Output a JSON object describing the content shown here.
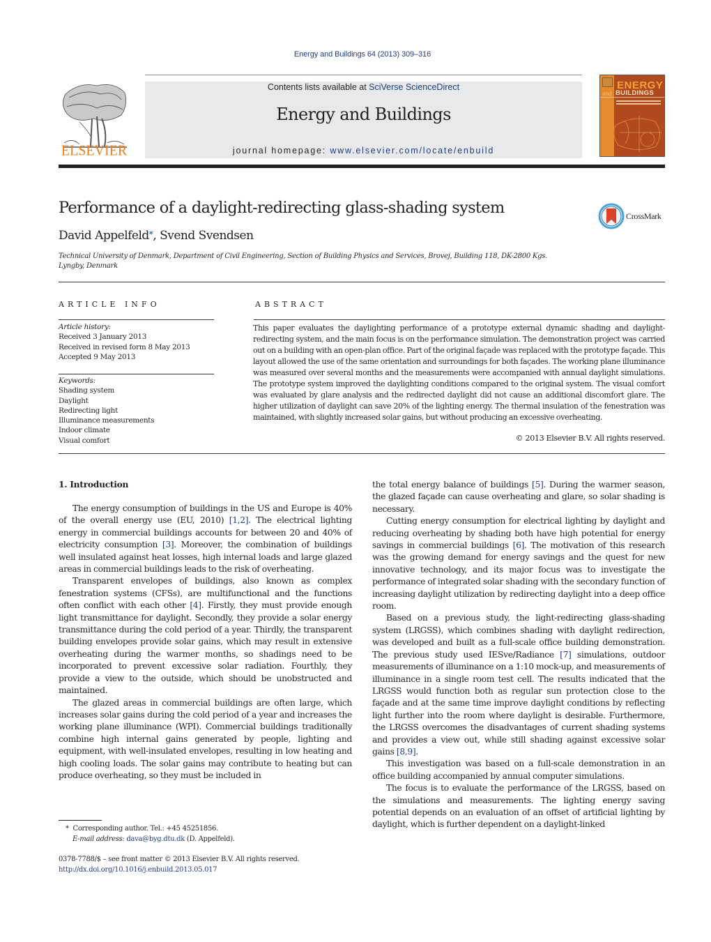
{
  "header": {
    "citation": "Energy and Buildings 64 (2013) 309–316",
    "contents_prefix": "Contents lists available at ",
    "contents_link": "SciVerse ScienceDirect",
    "journal_title": "Energy and Buildings",
    "homepage_prefix": "journal homepage: ",
    "homepage_link": "www.elsevier.com/locate/enbuild",
    "publisher_logo_text": "ELSEVIER",
    "cover": {
      "title_line1": "ENERGY",
      "title_and": "and",
      "title_line2": "BUILDINGS"
    },
    "colors": {
      "link": "#1f3c88",
      "elsevier_orange": "#f07f1a",
      "masthead_bg": "#e8e9ea"
    }
  },
  "article": {
    "title": "Performance of a daylight-redirecting glass-shading system",
    "crossmark_label": "CrossMark",
    "authors": {
      "author1": "David Appelfeld",
      "author1_mark": "*",
      "separator": ", ",
      "author2": "Svend Svendsen"
    },
    "affiliation": "Technical University of Denmark, Department of Civil Engineering, Section of Building Physics and Services, Brovej, Building 118, DK-2800 Kgs. Lyngby, Denmark"
  },
  "article_info": {
    "heading": "ARTICLE INFO",
    "history_label": "Article history:",
    "history": [
      "Received 3 January 2013",
      "Received in revised form 8 May 2013",
      "Accepted 9 May 2013"
    ],
    "keywords_label": "Keywords:",
    "keywords": [
      "Shading system",
      "Daylight",
      "Redirecting light",
      "Illuminance measurements",
      "Indoor climate",
      "Visual comfort"
    ]
  },
  "abstract": {
    "heading": "ABSTRACT",
    "text": "This paper evaluates the daylighting performance of a prototype external dynamic shading and daylight-redirecting system, and the main focus is on the performance simulation. The demonstration project was carried out on a building with an open-plan office. Part of the original façade was replaced with the prototype façade. This layout allowed the use of the same orientation and surroundings for both façades. The working plane illuminance was measured over several months and the measurements were accompanied with annual daylight simulations. The prototype system improved the daylighting conditions compared to the original system. The visual comfort was evaluated by glare analysis and the redirected daylight did not cause an additional discomfort glare. The higher utilization of daylight can save 20% of the lighting energy. The thermal insulation of the fenestration was maintained, with slightly increased solar gains, but without producing an excessive overheating.",
    "copyright": "© 2013 Elsevier B.V. All rights reserved."
  },
  "body": {
    "section_heading": "1.  Introduction",
    "left_column": [
      {
        "segments": [
          {
            "t": "The energy consumption of buildings in the US and Europe is 40% of the overall energy use (EU, 2010) "
          },
          {
            "t": "[1,2]",
            "ref": true
          },
          {
            "t": ". The electrical lighting energy in commercial buildings accounts for between 20 and 40% of electricity consumption "
          },
          {
            "t": "[3]",
            "ref": true
          },
          {
            "t": ". Moreover, the combination of buildings well insulated against heat losses, high internal loads and large glazed areas in commercial buildings leads to the risk of overheating."
          }
        ]
      },
      {
        "segments": [
          {
            "t": "Transparent envelopes of buildings, also known as complex fenestration systems (CFSs), are multifunctional and the functions often conflict with each other "
          },
          {
            "t": "[4]",
            "ref": true
          },
          {
            "t": ". Firstly, they must provide enough light transmittance for daylight. Secondly, they provide a solar energy transmittance during the cold period of a year. Thirdly, the transparent building envelopes provide solar gains, which may result in extensive overheating during the warmer months, so shadings need to be incorporated to prevent excessive solar radiation. Fourthly, they provide a view to the outside, which should be unobstructed and maintained."
          }
        ]
      },
      {
        "segments": [
          {
            "t": "The glazed areas in commercial buildings are often large, which increases solar gains during the cold period of a year and increases the working plane illuminance (WPI). Commercial buildings traditionally combine high internal gains generated by people, lighting and equipment, with well-insulated envelopes, resulting in low heating and high cooling loads. The solar gains may contribute to heating but can produce overheating, so they must be included in"
          }
        ]
      }
    ],
    "right_column": [
      {
        "noindent": true,
        "segments": [
          {
            "t": "the total energy balance of buildings "
          },
          {
            "t": "[5]",
            "ref": true
          },
          {
            "t": ". During the warmer season, the glazed façade can cause overheating and glare, so solar shading is necessary."
          }
        ]
      },
      {
        "segments": [
          {
            "t": "Cutting energy consumption for electrical lighting by daylight and reducing overheating by shading both have high potential for energy savings in commercial buildings "
          },
          {
            "t": "[6]",
            "ref": true
          },
          {
            "t": ". The motivation of this research was the growing demand for energy savings and the quest for new innovative technology, and its major focus was to investigate the performance of integrated solar shading with the secondary function of increasing daylight utilization by redirecting daylight into a deep office room."
          }
        ]
      },
      {
        "segments": [
          {
            "t": "Based on a previous study, the light-redirecting glass-shading system (LRGSS), which combines shading with daylight redirection, was developed and built as a full-scale office building demonstration. The previous study used IESve/Radiance "
          },
          {
            "t": "[7]",
            "ref": true
          },
          {
            "t": " simulations, outdoor measurements of illuminance on a 1:10 mock-up, and measurements of illuminance in a single room test cell. The results indicated that the LRGSS would function both as regular sun protection close to the façade and at the same time improve daylight conditions by reflecting light further into the room where daylight is desirable. Furthermore, the LRGSS overcomes the disadvantages of current shading systems and provides a view out, while still shading against excessive solar gains "
          },
          {
            "t": "[8,9]",
            "ref": true
          },
          {
            "t": "."
          }
        ]
      },
      {
        "segments": [
          {
            "t": "This investigation was based on a full-scale demonstration in an office building accompanied by annual computer simulations."
          }
        ]
      },
      {
        "segments": [
          {
            "t": "The focus is to evaluate the performance of the LRGSS, based on the simulations and measurements. The lighting energy saving potential depends on an evaluation of an offset of artificial lighting by daylight, which is further dependent on a daylight-linked"
          }
        ]
      }
    ]
  },
  "footnotes": {
    "mark": "*",
    "corresponding": "Corresponding author. Tel.: +45 45251856.",
    "email_label": "E-mail address: ",
    "email": "dava@byg.dtu.dk",
    "email_suffix": " (D. Appelfeld).",
    "front_matter": "0378-7788/$ – see front matter © 2013 Elsevier B.V. All rights reserved.",
    "doi": "http://dx.doi.org/10.1016/j.enbuild.2013.05.017"
  }
}
